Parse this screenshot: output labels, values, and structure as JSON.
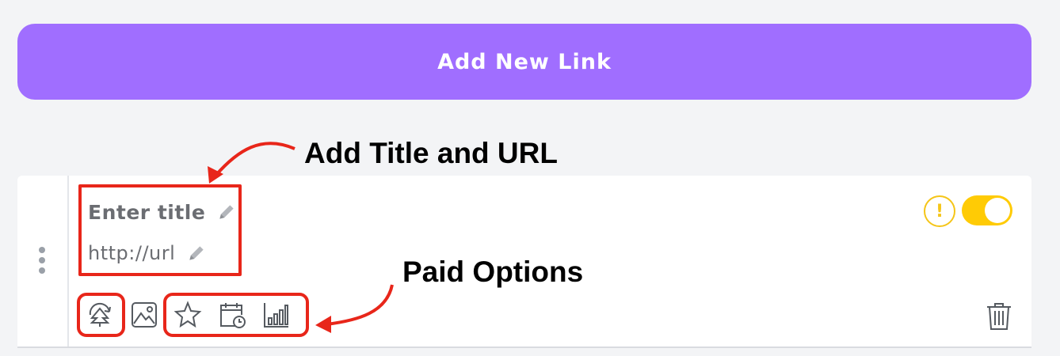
{
  "add_button": {
    "label": "Add New Link"
  },
  "link_card": {
    "title_placeholder": "Enter title",
    "url_placeholder": "http://url",
    "warning_glyph": "!",
    "toggle_state": "on",
    "action_icons": [
      "linktree-icon",
      "image-icon",
      "star-icon",
      "calendar-clock-icon",
      "analytics-icon"
    ],
    "delete_icon": "trash-icon"
  },
  "annotations": {
    "title_url": "Add Title and URL",
    "paid_options": "Paid Options"
  },
  "colors": {
    "accent": "#a06eff",
    "toggle": "#ffcb05",
    "annotation": "#e8261a"
  }
}
